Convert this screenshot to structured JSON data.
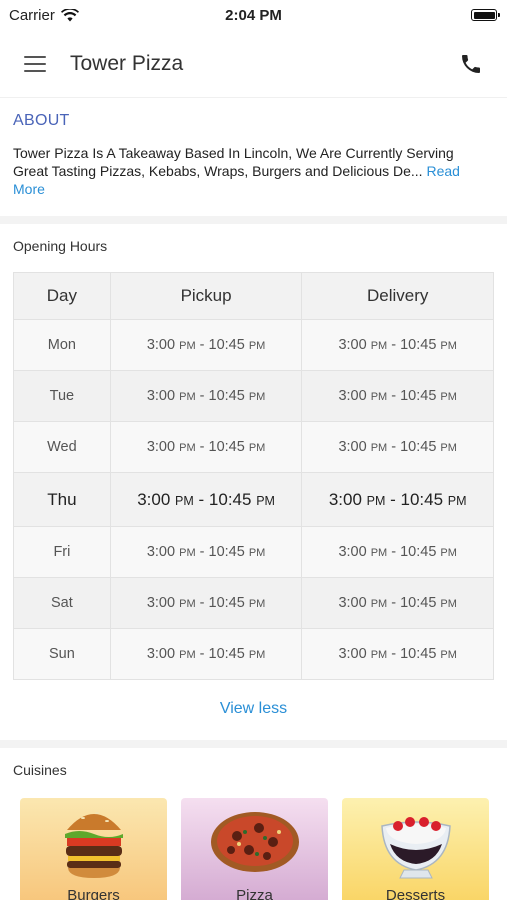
{
  "status": {
    "carrier": "Carrier",
    "time": "2:04 PM"
  },
  "nav": {
    "title": "Tower Pizza"
  },
  "about": {
    "title": "ABOUT",
    "line1": "Tower Pizza Is A Takeaway Based In Lincoln, We Are Currently Serving",
    "line2": "Great Tasting Pizzas, Kebabs, Wraps, Burgers and Delicious De...",
    "read_more": "Read More"
  },
  "hours": {
    "label": "Opening Hours",
    "headers": [
      "Day",
      "Pickup",
      "Delivery"
    ],
    "rows": [
      {
        "day": "Mon",
        "p_from": "3:00",
        "p_from_ap": "PM",
        "p_to": "10:45",
        "p_to_ap": "PM",
        "d_from": "3:00",
        "d_from_ap": "PM",
        "d_to": "10:45",
        "d_to_ap": "PM"
      },
      {
        "day": "Tue",
        "p_from": "3:00",
        "p_from_ap": "PM",
        "p_to": "10:45",
        "p_to_ap": "PM",
        "d_from": "3:00",
        "d_from_ap": "PM",
        "d_to": "10:45",
        "d_to_ap": "PM"
      },
      {
        "day": "Wed",
        "p_from": "3:00",
        "p_from_ap": "PM",
        "p_to": "10:45",
        "p_to_ap": "PM",
        "d_from": "3:00",
        "d_from_ap": "PM",
        "d_to": "10:45",
        "d_to_ap": "PM"
      },
      {
        "day": "Thu",
        "p_from": "3:00",
        "p_from_ap": "PM",
        "p_to": "10:45",
        "p_to_ap": "PM",
        "d_from": "3:00",
        "d_from_ap": "PM",
        "d_to": "10:45",
        "d_to_ap": "PM"
      },
      {
        "day": "Fri",
        "p_from": "3:00",
        "p_from_ap": "PM",
        "p_to": "10:45",
        "p_to_ap": "PM",
        "d_from": "3:00",
        "d_from_ap": "PM",
        "d_to": "10:45",
        "d_to_ap": "PM"
      },
      {
        "day": "Sat",
        "p_from": "3:00",
        "p_from_ap": "PM",
        "p_to": "10:45",
        "p_to_ap": "PM",
        "d_from": "3:00",
        "d_from_ap": "PM",
        "d_to": "10:45",
        "d_to_ap": "PM"
      },
      {
        "day": "Sun",
        "p_from": "3:00",
        "p_from_ap": "PM",
        "p_to": "10:45",
        "p_to_ap": "PM",
        "d_from": "3:00",
        "d_from_ap": "PM",
        "d_to": "10:45",
        "d_to_ap": "PM"
      }
    ],
    "view_less": "View less"
  },
  "cuisines": {
    "label": "Cuisines",
    "items": [
      {
        "name": "Burgers",
        "icon": "burger-icon"
      },
      {
        "name": "Pizza",
        "icon": "pizza-icon"
      },
      {
        "name": "Desserts",
        "icon": "dessert-icon"
      }
    ]
  },
  "colors": {
    "accent": "#4a64b8",
    "link": "#2a8fd6"
  }
}
